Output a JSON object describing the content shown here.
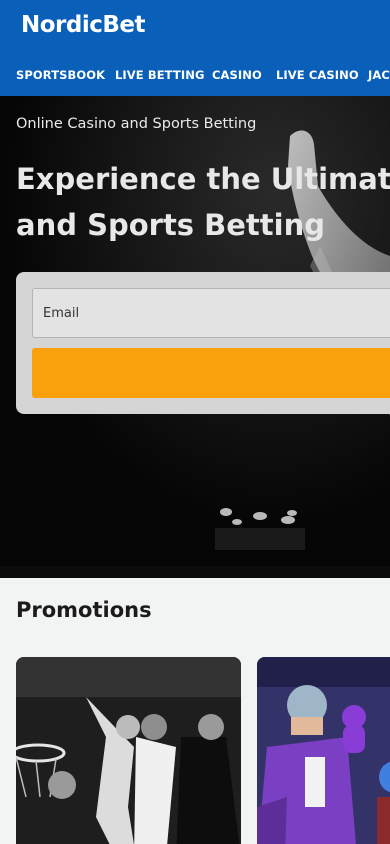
{
  "brand": {
    "logo_text": "NordicBet"
  },
  "nav": {
    "items": [
      {
        "label": "SPORTSBOOK"
      },
      {
        "label": "LIVE BETTING"
      },
      {
        "label": "CASINO"
      },
      {
        "label": "LIVE CASINO"
      },
      {
        "label": "JAC"
      }
    ]
  },
  "hero": {
    "subtitle": "Online Casino and Sports Betting",
    "title_line1": "Experience the Ultimate N",
    "title_line2": "and Sports Betting"
  },
  "signup": {
    "email_placeholder": "Email"
  },
  "promotions": {
    "title": "Promotions"
  },
  "colors": {
    "header_bg": "#0a60b9",
    "cta": "#f9a10c",
    "page_bg": "#f2f3f3"
  }
}
